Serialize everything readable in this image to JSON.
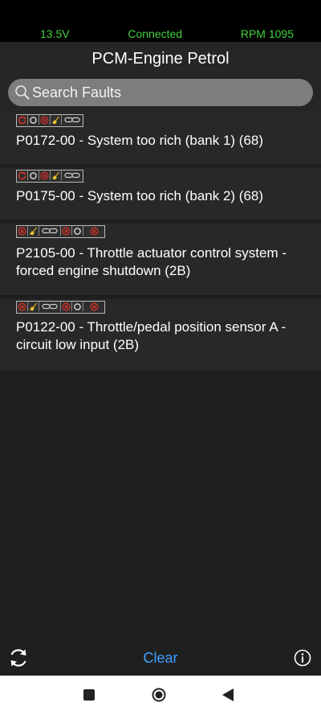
{
  "status": {
    "voltage": "13.5V",
    "connection": "Connected",
    "rpm": "RPM 1095"
  },
  "header": {
    "title": "PCM-Engine Petrol"
  },
  "search": {
    "placeholder": "Search Faults"
  },
  "faults": [
    {
      "code": "P0172-00 - System too rich (bank 1) (68)",
      "badges": [
        "retry-icon",
        "circle-icon",
        "x-icon",
        "broom-icon",
        "chain-icon"
      ]
    },
    {
      "code": "P0175-00 - System too rich (bank 2) (68)",
      "badges": [
        "retry-icon",
        "circle-icon",
        "x-icon",
        "broom-icon",
        "chain-icon"
      ]
    },
    {
      "code": "P2105-00 - Throttle actuator control system - forced engine shutdown (2B)",
      "badges": [
        "x-icon",
        "broom-icon",
        "chain-icon",
        "x-icon",
        "circle-icon",
        "x-icon"
      ]
    },
    {
      "code": "P0122-00 - Throttle/pedal position sensor A - circuit low input (2B)",
      "badges": [
        "x-icon",
        "broom-icon",
        "chain-icon",
        "x-icon",
        "circle-icon",
        "x-icon"
      ]
    }
  ],
  "toolbar": {
    "clear_label": "Clear"
  },
  "colors": {
    "status_green": "#43d13d",
    "accent_blue": "#3fa0ff",
    "badge_red": "#e0302a"
  }
}
